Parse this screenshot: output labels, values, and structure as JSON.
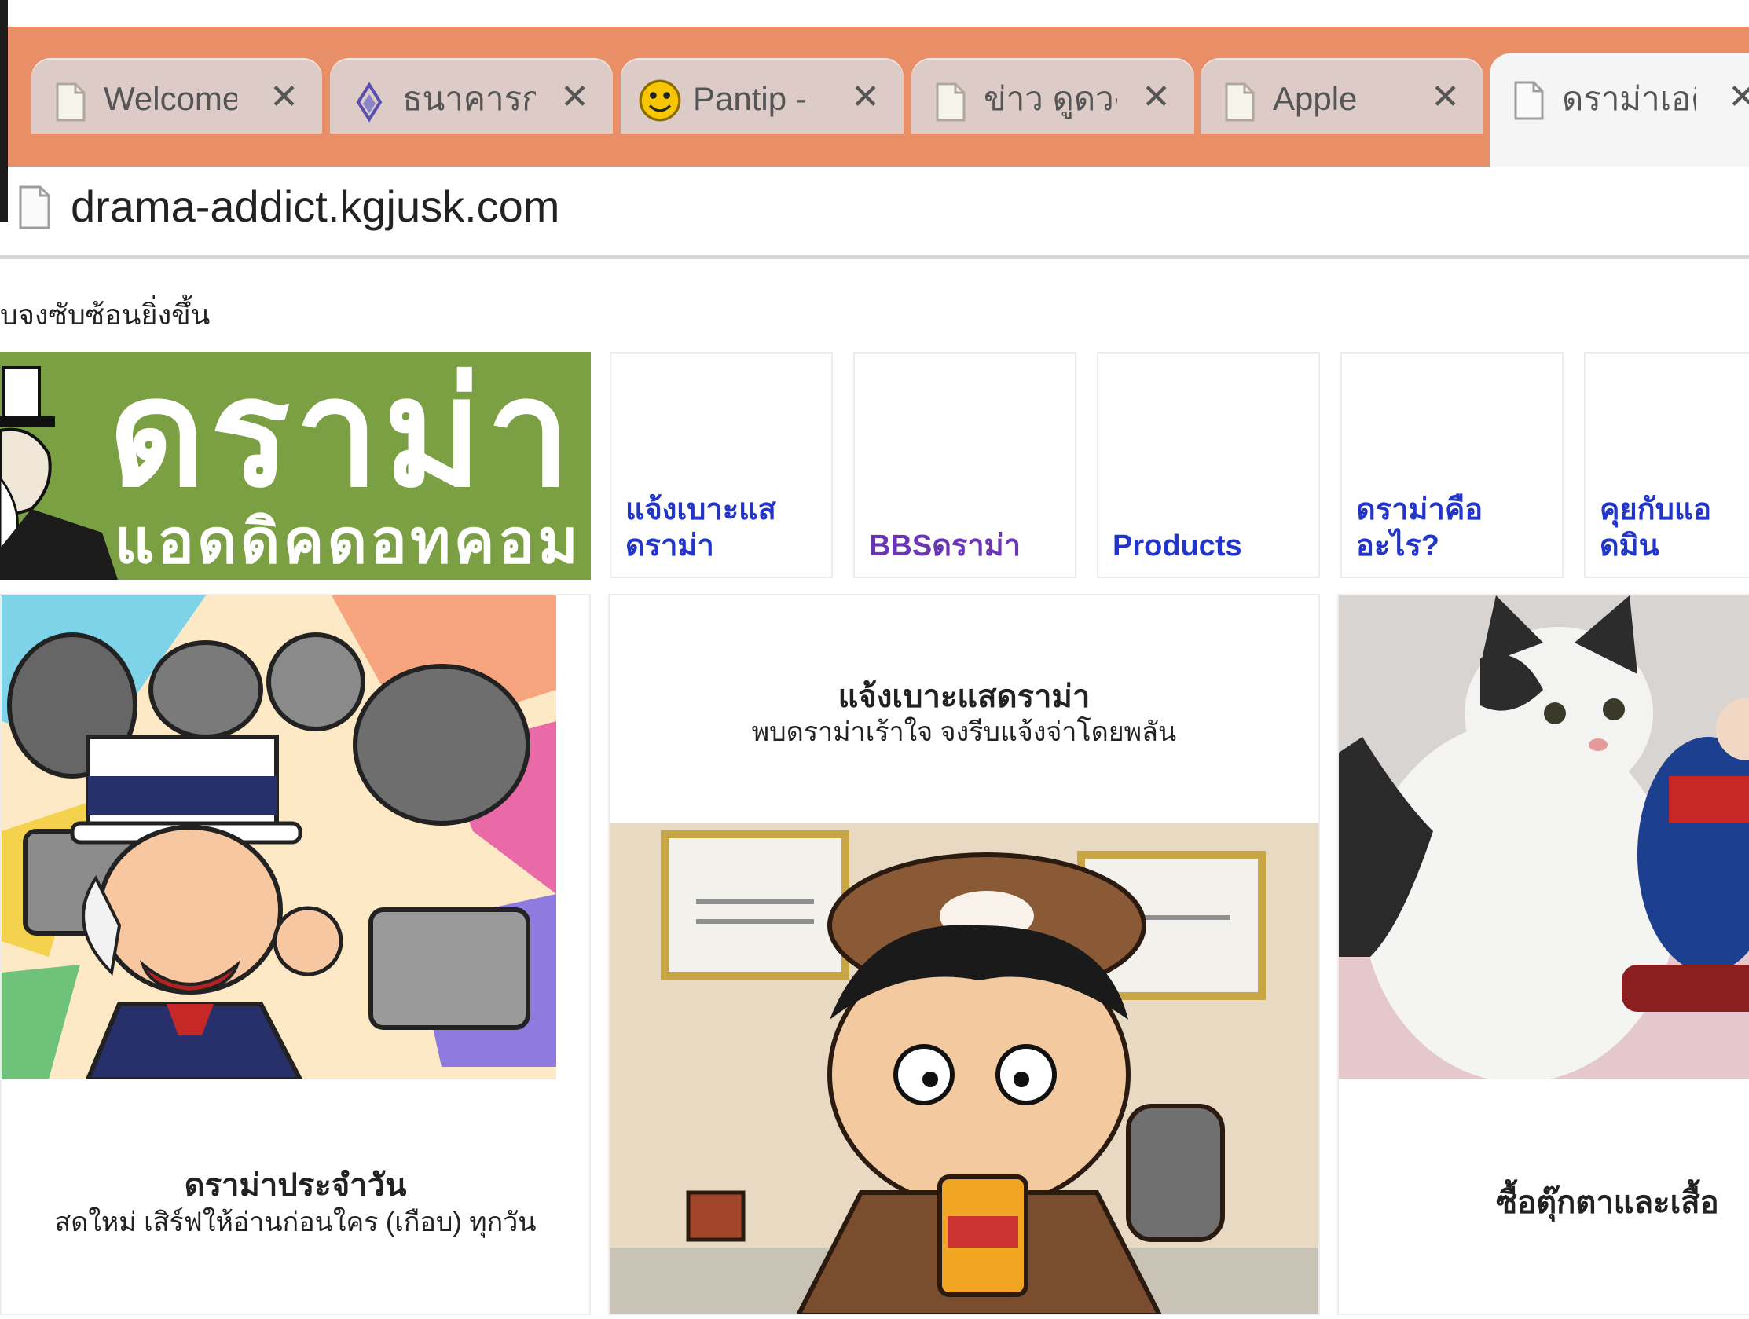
{
  "browser": {
    "tabs": [
      {
        "title": "Welcome",
        "icon": "document-icon"
      },
      {
        "title": "ธนาคารกรุ",
        "icon": "bank-logo-icon"
      },
      {
        "title": "Pantip - ",
        "icon": "pantip-smiley-icon"
      },
      {
        "title": "ข่าว ดูดวง",
        "icon": "document-icon"
      },
      {
        "title": "Apple",
        "icon": "document-icon"
      },
      {
        "title": "ดราม่าเอดิ",
        "icon": "document-icon",
        "active": true
      }
    ],
    "close_glyph": "✕",
    "url": "drama-addict.kgjusk.com",
    "chrome_color": "#e98f68"
  },
  "page": {
    "tagline": "บจงซับซ้อนยิ่งขึ้น",
    "logo": {
      "main": "ดราม่า",
      "sub": "แอดดิคดอทคอม",
      "bg": "#7ba043"
    },
    "nav": [
      {
        "label": "แจ้งเบาะแส ดราม่า",
        "visited": false
      },
      {
        "label": "BBSดราม่า",
        "visited": true
      },
      {
        "label": "Products",
        "visited": false
      },
      {
        "label": "ดราม่าคือ อะไร?",
        "visited": false
      },
      {
        "label": "คุยกับแอ ดมิน",
        "visited": false
      }
    ],
    "cards": {
      "daily": {
        "title": "ดราม่าประจำวัน",
        "subtitle": "สดใหม่ เสิร์ฟให้อ่านก่อนใคร (เกือบ) ทุกวัน"
      },
      "report": {
        "title": "แจ้งเบาะแสดราม่า",
        "subtitle": "พบดราม่าเร้าใจ จงรีบแจ้งจ่าโดยพลัน"
      },
      "shop": {
        "title": "ซื้อตุ๊กตาและเสื้อ"
      }
    },
    "images": {
      "daily": "cartoon-uncle-sam-pointing",
      "report": "cartoon-boy-eating-noodles",
      "shop": "photo-cat-with-dolls"
    }
  }
}
